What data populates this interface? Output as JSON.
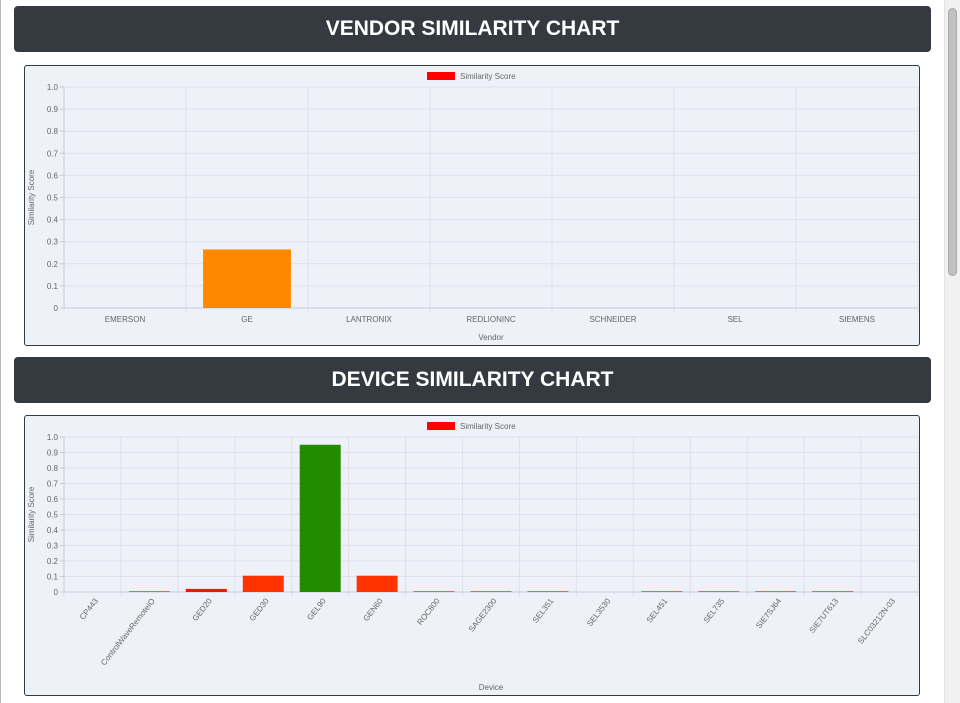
{
  "vendor_header": {
    "title": "VENDOR SIMILARITY CHART"
  },
  "device_header": {
    "title": "DEVICE SIMILARITY CHART"
  },
  "chart_data": [
    {
      "type": "bar",
      "legend_label": "Similarity Score",
      "legend_color": "#ff0000",
      "legend_position": "top",
      "xlabel": "Vendor",
      "ylabel": "Similarity Score",
      "ylim": [
        0,
        1.0
      ],
      "yticks": [
        "0",
        "0.1",
        "0.2",
        "0.3",
        "0.4",
        "0.5",
        "0.6",
        "0.7",
        "0.8",
        "0.9",
        "1.0"
      ],
      "grid": true,
      "categories": [
        "EMERSON",
        "GE",
        "LANTRONIX",
        "REDLIONINC",
        "SCHNEIDER",
        "SEL",
        "SIEMENS"
      ],
      "values": [
        0,
        0.265,
        0,
        0,
        0,
        0,
        0
      ],
      "colors": [
        "#ff0000",
        "#ff8800",
        "#ff0000",
        "#ff0000",
        "#ff0000",
        "#ff0000",
        "#ff0000"
      ]
    },
    {
      "type": "bar",
      "legend_label": "Similarity Score",
      "legend_color": "#ff0000",
      "legend_position": "top",
      "xlabel": "Device",
      "ylabel": "Similarity Score",
      "ylim": [
        0,
        1.0
      ],
      "yticks": [
        "0",
        "0.1",
        "0.2",
        "0.3",
        "0.4",
        "0.5",
        "0.6",
        "0.7",
        "0.8",
        "0.9",
        "1.0"
      ],
      "grid": true,
      "categories": [
        "CP443",
        "ControlWaveRemoteIO",
        "GED20",
        "GED30",
        "GEL90",
        "GEN60",
        "ROC800",
        "SAGE2300",
        "SEL351",
        "SEL3530",
        "SEL451",
        "SEL735",
        "SIE7SJ64",
        "SIE7UT613",
        "SLC03212N-03"
      ],
      "values": [
        0,
        0.004,
        0.02,
        0.105,
        0.95,
        0.105,
        0.004,
        0.004,
        0.004,
        0,
        0.004,
        0.004,
        0.004,
        0.004,
        0
      ],
      "colors": [
        "#ff0000",
        "#ff0000",
        "#ff1100",
        "#ff3300",
        "#228b00",
        "#ff3300",
        "#ff0000",
        "#ff0000",
        "#ff0000",
        "#ff0000",
        "#ff0000",
        "#ff0000",
        "#ff0000",
        "#ff0000",
        "#ff0000"
      ]
    }
  ]
}
